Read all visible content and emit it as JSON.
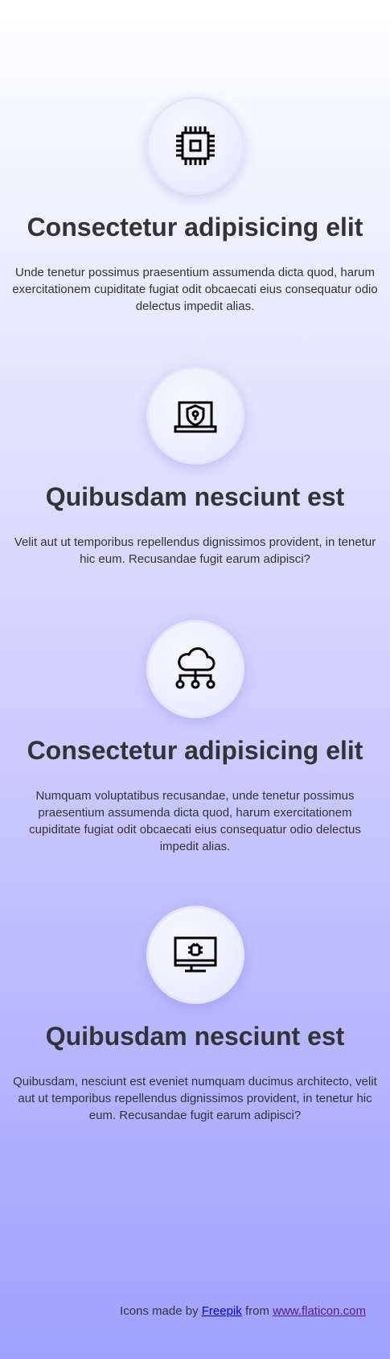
{
  "features": [
    {
      "icon": "cpu-chip-icon",
      "title": "Consectetur adipisicing elit",
      "text": "Unde tenetur possimus praesentium assumenda dicta quod, harum exercitationem cupiditate fugiat odit obcaecati eius consequatur odio delectus impedit alias."
    },
    {
      "icon": "laptop-shield-icon",
      "title": "Quibusdam nesciunt est",
      "text": "Velit aut ut temporibus repellendus dignissimos provident, in tenetur hic eum. Recusandae fugit earum adipisci?"
    },
    {
      "icon": "cloud-network-icon",
      "title": "Consectetur adipisicing elit",
      "text": "Numquam voluptatibus recusandae, unde tenetur possimus praesentium assumenda dicta quod, harum exercitationem cupiditate fugiat odit obcaecati eius consequatur odio delectus impedit alias."
    },
    {
      "icon": "monitor-bug-icon",
      "title": "Quibusdam nesciunt est",
      "text": "Quibusdam, nesciunt est eveniet numquam ducimus architecto, velit aut ut temporibus repellendus dignissimos provident, in tenetur hic eum. Recusandae fugit earum adipisci?"
    }
  ],
  "footer": {
    "prefix": "Icons made by ",
    "author": "Freepik",
    "middle": " from ",
    "site": "www.flaticon.com"
  }
}
